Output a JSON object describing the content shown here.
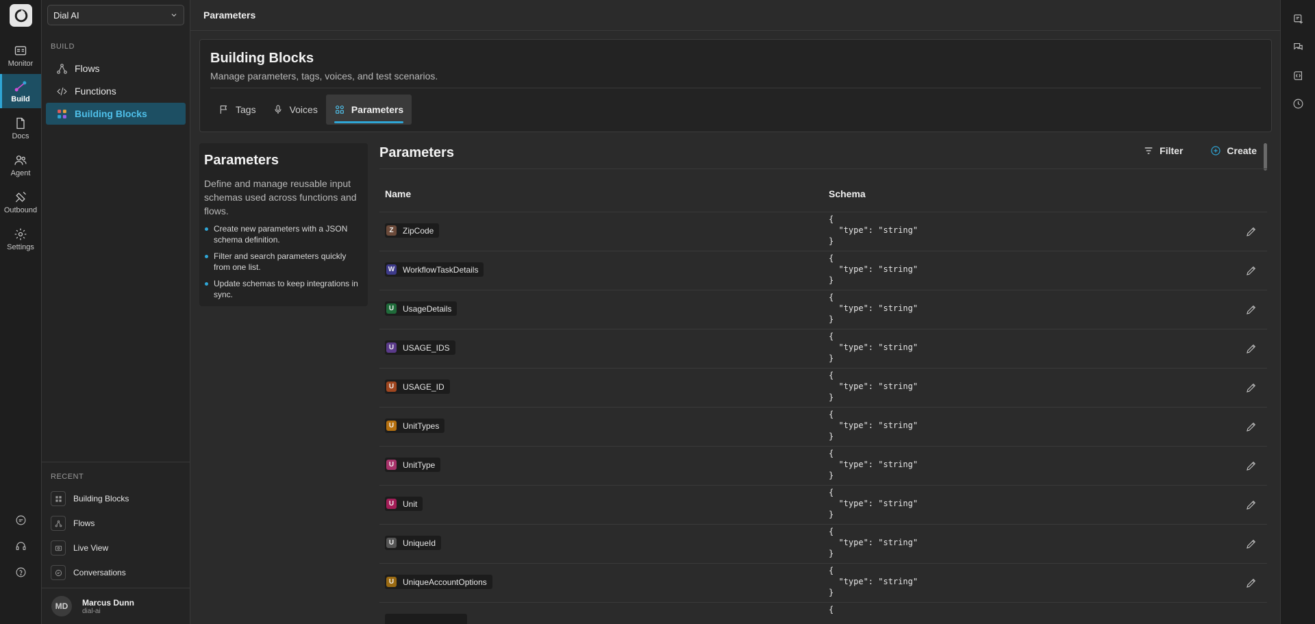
{
  "workspace": {
    "name": "Dial AI"
  },
  "rail": {
    "items": [
      {
        "label": "Monitor",
        "icon": "monitor-icon",
        "active": false
      },
      {
        "label": "Build",
        "icon": "build-icon",
        "active": true
      },
      {
        "label": "Docs",
        "icon": "docs-icon",
        "active": false
      },
      {
        "label": "Agent",
        "icon": "agent-icon",
        "active": false
      },
      {
        "label": "Outbound",
        "icon": "outbound-icon",
        "active": false
      },
      {
        "label": "Settings",
        "icon": "gear-icon",
        "active": false
      }
    ]
  },
  "sidebar": {
    "section_label": "BUILD",
    "items": [
      {
        "label": "Flows",
        "icon": "flows-icon"
      },
      {
        "label": "Functions",
        "icon": "code-icon"
      },
      {
        "label": "Building Blocks",
        "icon": "blocks-icon",
        "active": true
      }
    ],
    "recent_label": "RECENT",
    "recent": [
      {
        "label": "Building Blocks",
        "icon": "blocks-icon"
      },
      {
        "label": "Flows",
        "icon": "flows-icon"
      },
      {
        "label": "Live View",
        "icon": "live-view-icon"
      },
      {
        "label": "Conversations",
        "icon": "chat-icon"
      }
    ]
  },
  "user": {
    "initials": "MD",
    "name": "Marcus Dunn",
    "org": "dial-ai"
  },
  "topbar": {
    "title": "Parameters"
  },
  "header": {
    "title": "Building Blocks",
    "subtitle": "Manage parameters, tags, voices, and test scenarios.",
    "tabs": [
      {
        "label": "Tags",
        "icon": "flag-icon"
      },
      {
        "label": "Voices",
        "icon": "mic-icon"
      },
      {
        "label": "Parameters",
        "icon": "grid-icon",
        "active": true
      }
    ]
  },
  "info": {
    "title": "Parameters",
    "description": "Define and manage reusable input schemas used across functions and flows.",
    "bullets": [
      "Create new parameters with a JSON schema definition.",
      "Filter and search parameters quickly from one list.",
      "Update schemas to keep integrations in sync."
    ]
  },
  "main": {
    "title": "Parameters",
    "filter_label": "Filter",
    "create_label": "Create",
    "col_name": "Name",
    "col_schema": "Schema",
    "rows": [
      {
        "letter": "Z",
        "name": "ZipCode",
        "color": "#6b4a3a",
        "schema": "{\n  \"type\": \"string\"\n}"
      },
      {
        "letter": "W",
        "name": "WorkflowTaskDetails",
        "color": "#3d3a8a",
        "schema": "{\n  \"type\": \"string\"\n}"
      },
      {
        "letter": "U",
        "name": "UsageDetails",
        "color": "#1f6b3a",
        "schema": "{\n  \"type\": \"string\"\n}"
      },
      {
        "letter": "U",
        "name": "USAGE_IDS",
        "color": "#5a3a8a",
        "schema": "{\n  \"type\": \"string\"\n}"
      },
      {
        "letter": "U",
        "name": "USAGE_ID",
        "color": "#a0461f",
        "schema": "{\n  \"type\": \"string\"\n}"
      },
      {
        "letter": "U",
        "name": "UnitTypes",
        "color": "#b5700f",
        "schema": "{\n  \"type\": \"string\"\n}"
      },
      {
        "letter": "U",
        "name": "UnitType",
        "color": "#a8326a",
        "schema": "{\n  \"type\": \"string\"\n}"
      },
      {
        "letter": "U",
        "name": "Unit",
        "color": "#a31d57",
        "schema": "{\n  \"type\": \"string\"\n}"
      },
      {
        "letter": "U",
        "name": "UniqueId",
        "color": "#555555",
        "schema": "{\n  \"type\": \"string\"\n}"
      },
      {
        "letter": "U",
        "name": "UniqueAccountOptions",
        "color": "#9a6a12",
        "schema": "{\n  \"type\": \"string\"\n}"
      },
      {
        "letter": "",
        "name": "",
        "color": "#a0461f",
        "schema": "{"
      }
    ]
  }
}
